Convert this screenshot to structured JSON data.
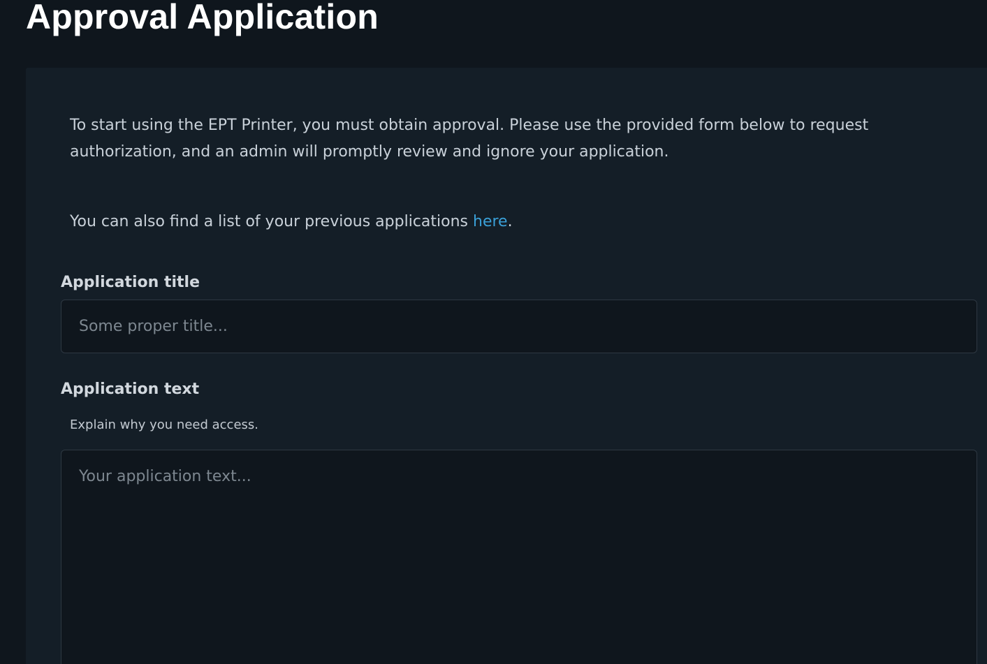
{
  "page": {
    "title": "Approval Application"
  },
  "intro": {
    "text": "To start using the EPT Printer, you must obtain approval. Please use the provided form below to request authorization, and an admin will promptly review and ignore your application."
  },
  "previous_applications": {
    "text_before": "You can also find a list of your previous applications ",
    "link_text": "here",
    "text_after": "."
  },
  "form": {
    "title_label": "Application title",
    "title_placeholder": "Some proper title...",
    "text_label": "Application text",
    "text_helper": "Explain why you need access.",
    "text_placeholder": "Your application text..."
  },
  "colors": {
    "background": "#0f161d",
    "card": "#141e27",
    "link": "#3aa0d8"
  }
}
